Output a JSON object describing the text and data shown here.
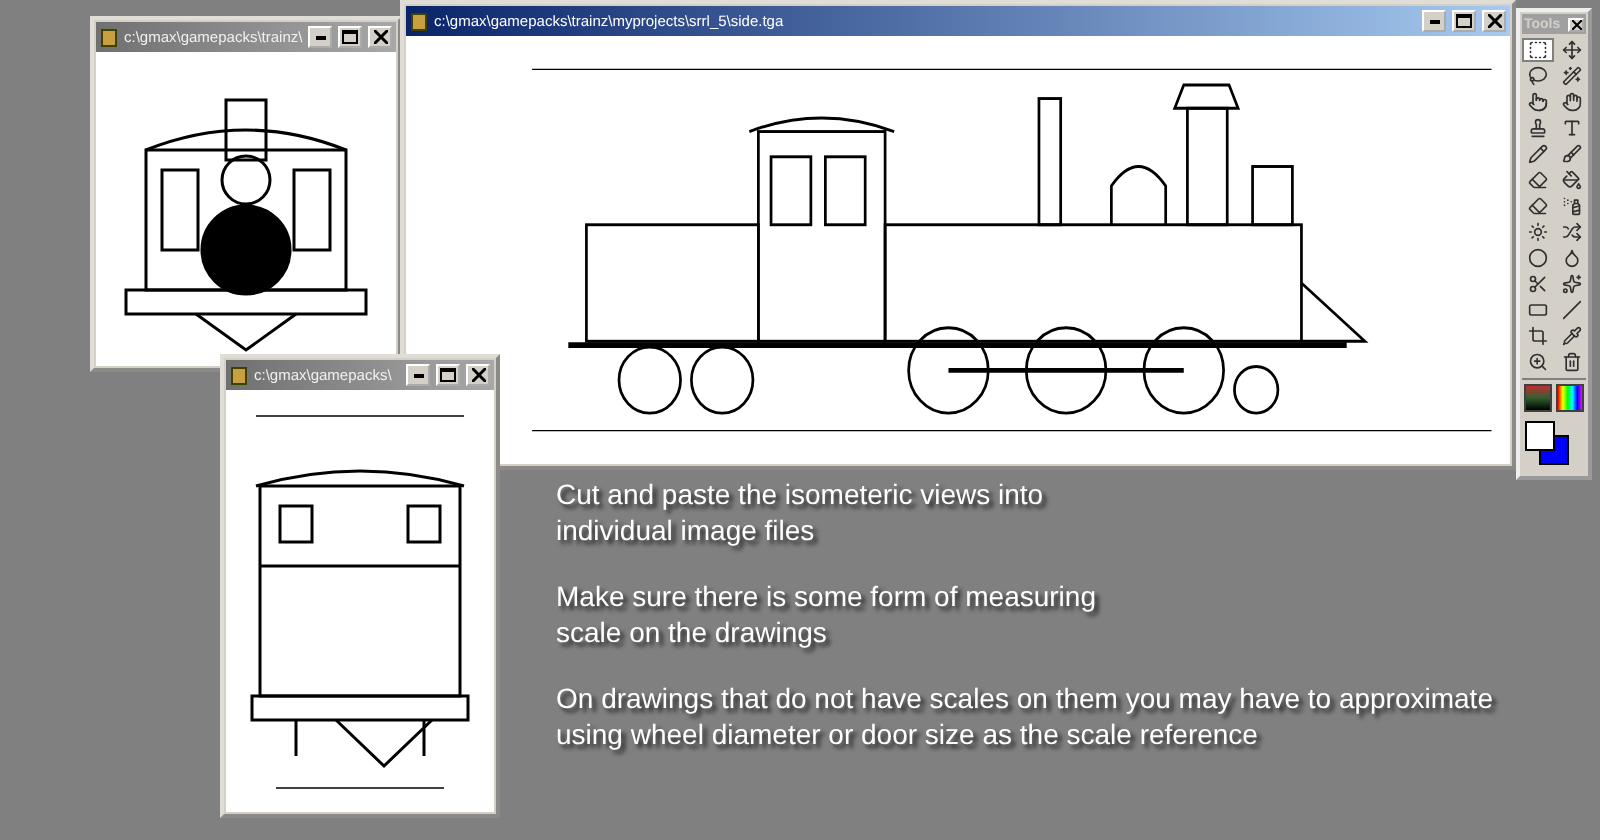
{
  "windows": [
    {
      "kind": "front",
      "title": "c:\\gmax\\gamepacks\\trainz\\",
      "active": false
    },
    {
      "kind": "side",
      "title": "c:\\gmax\\gamepacks\\trainz\\myprojects\\srrl_5\\side.tga",
      "active": true
    },
    {
      "kind": "rear",
      "title": "c:\\gmax\\gamepacks\\",
      "active": false
    }
  ],
  "tools_palette": {
    "title": "Tools",
    "tools": [
      {
        "kind": "select",
        "selected": true
      },
      {
        "kind": "move",
        "selected": false
      },
      {
        "kind": "lasso",
        "selected": false
      },
      {
        "kind": "wand",
        "selected": false
      },
      {
        "kind": "smudge",
        "selected": false
      },
      {
        "kind": "hand",
        "selected": false
      },
      {
        "kind": "stamp",
        "selected": false
      },
      {
        "kind": "text",
        "selected": false
      },
      {
        "kind": "pencil",
        "selected": false
      },
      {
        "kind": "brush",
        "selected": false
      },
      {
        "kind": "eraser",
        "selected": false
      },
      {
        "kind": "bucket",
        "selected": false
      },
      {
        "kind": "eraser",
        "selected": false
      },
      {
        "kind": "spray",
        "selected": false
      },
      {
        "kind": "sun",
        "selected": false
      },
      {
        "kind": "shuffle",
        "selected": false
      },
      {
        "kind": "blur",
        "selected": false
      },
      {
        "kind": "droplet",
        "selected": false
      },
      {
        "kind": "scissors",
        "selected": false
      },
      {
        "kind": "sparkle",
        "selected": false
      },
      {
        "kind": "rect",
        "selected": false
      },
      {
        "kind": "line",
        "selected": false
      },
      {
        "kind": "crop",
        "selected": false
      },
      {
        "kind": "pipette",
        "selected": false
      },
      {
        "kind": "zoom",
        "selected": false
      },
      {
        "kind": "trash",
        "selected": false
      }
    ]
  },
  "instructions": [
    "Cut and paste the isometeric views into\nindividual image files",
    "Make sure there is some form of measuring\nscale on the drawings",
    "On drawings that do not have scales on them you may have to approximate\nusing wheel diameter or door size as the scale reference"
  ]
}
